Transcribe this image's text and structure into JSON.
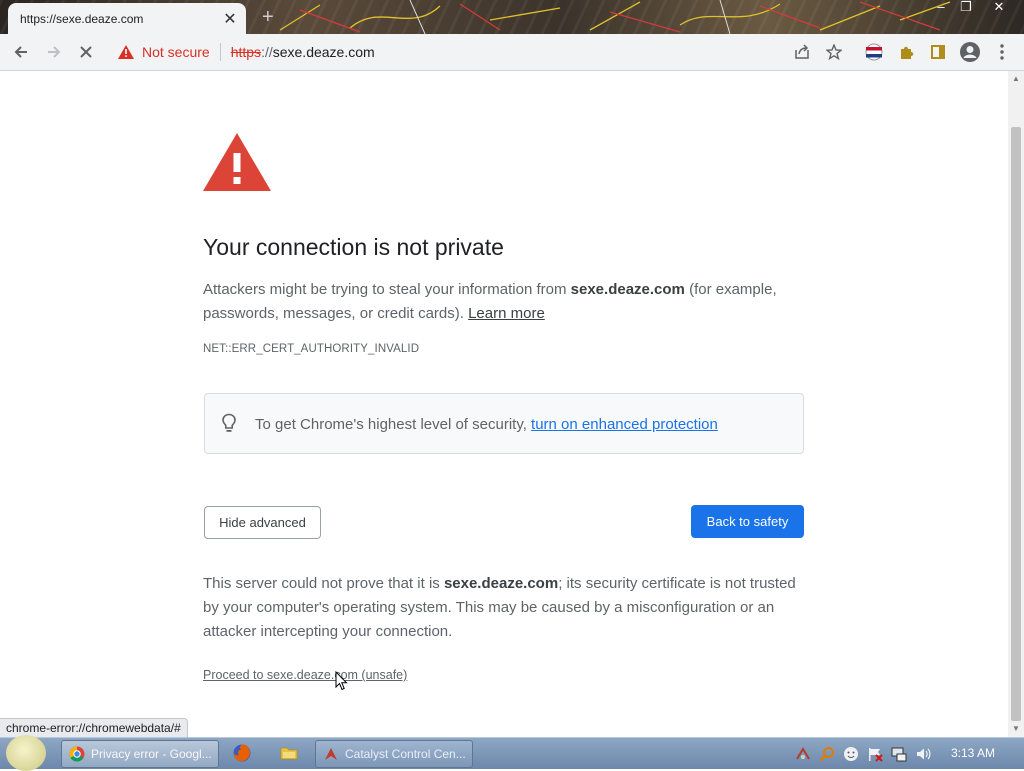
{
  "browser": {
    "tab_title": "https://sexe.deaze.com",
    "security_label": "Not secure",
    "url_scheme": "https",
    "url_separator": "://",
    "url_host": "sexe.deaze.com"
  },
  "page": {
    "heading": "Your connection is not private",
    "intro_before": "Attackers might be trying to steal your information from ",
    "intro_host": "sexe.deaze.com",
    "intro_after": " (for example, passwords, messages, or credit cards). ",
    "learn_more": "Learn more",
    "error_code": "NET::ERR_CERT_AUTHORITY_INVALID",
    "enhanced_text": "To get Chrome's highest level of security, ",
    "enhanced_link": "turn on enhanced protection",
    "hide_advanced_label": "Hide advanced",
    "back_to_safety_label": "Back to safety",
    "details_before": "This server could not prove that it is ",
    "details_host": "sexe.deaze.com",
    "details_after": "; its security certificate is not trusted by your computer's operating system. This may be caused by a misconfiguration or an attacker intercepting your connection.",
    "proceed_link": "Proceed to sexe.deaze.com (unsafe)",
    "status_url": "chrome-error://chromewebdata/#"
  },
  "taskbar": {
    "tasks": [
      {
        "label": "Privacy error - Googl...",
        "icon": "chrome-icon"
      },
      {
        "label": "Catalyst Control Cen...",
        "icon": "catalyst-icon"
      }
    ],
    "quick_launch": [
      "firefox-icon",
      "folder-icon"
    ],
    "tray": [
      "network-icon",
      "magnifier-icon",
      "smiley-icon",
      "flag-icon",
      "monitor-icon",
      "speaker-icon"
    ],
    "clock": "3:13 AM"
  },
  "colors": {
    "warning_red": "#d93025",
    "link_blue": "#1a73e8",
    "primary_button": "#1a73e8"
  }
}
